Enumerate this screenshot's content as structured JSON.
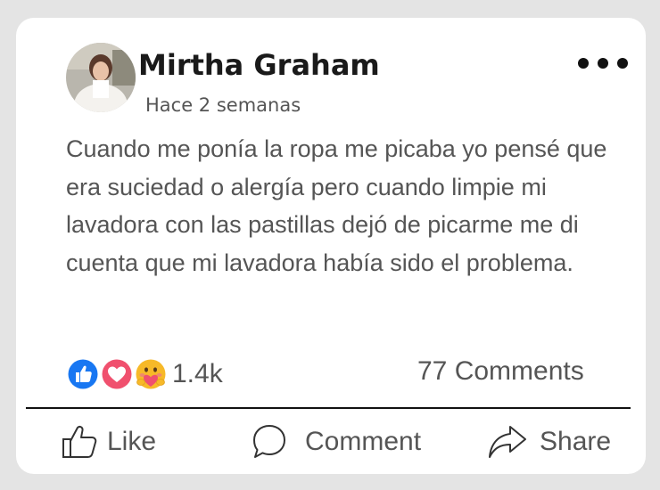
{
  "post": {
    "author": "Mirtha Graham",
    "timestamp": "Hace 2 semanas",
    "body": "Cuando me ponía la ropa me picaba yo pensé que era suciedad o alergía pero cuando limpie mi lavadora con las pastillas dejó de picarme me di cuenta que mi lavadora había sido el problema."
  },
  "reactions": {
    "icons": [
      "like-icon",
      "love-icon",
      "care-icon"
    ],
    "count": "1.4k"
  },
  "comments_count": "77 Comments",
  "actions": {
    "like_label": "Like",
    "comment_label": "Comment",
    "share_label": "Share"
  },
  "colors": {
    "like_blue": "#1877f2",
    "love_red": "#f0506e",
    "care_yellow": "#f7b928",
    "text_gray": "#555555",
    "author_black": "#1a1a1a",
    "page_bg": "#e4e4e4"
  }
}
